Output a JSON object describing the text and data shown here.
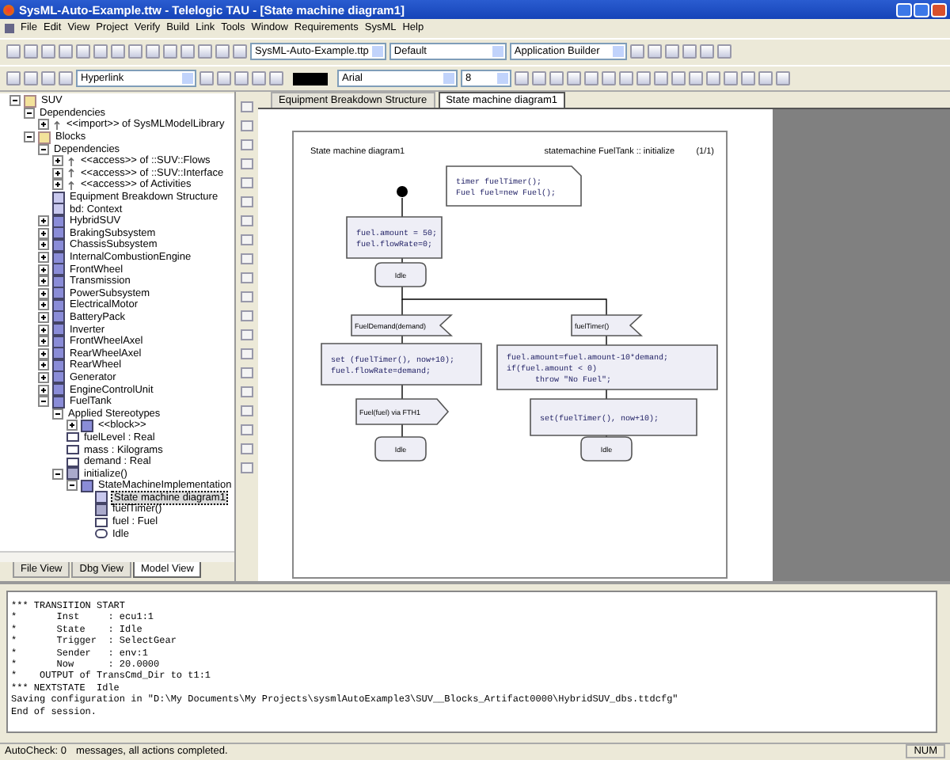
{
  "window": {
    "title": "SysML-Auto-Example.ttw - Telelogic TAU - [State machine diagram1]"
  },
  "menu": [
    "File",
    "Edit",
    "View",
    "Project",
    "Verify",
    "Build",
    "Link",
    "Tools",
    "Window",
    "Requirements",
    "SysML",
    "Help"
  ],
  "toolbar": {
    "project": "SysML-Auto-Example.ttp",
    "configuration": "Default",
    "builder": "Application Builder",
    "link_type": "Hyperlink",
    "font": "Arial",
    "font_size": "8"
  },
  "tree": [
    {
      "label": "SUV",
      "kind": "folder",
      "expanded": true,
      "children": [
        {
          "label": "Dependencies",
          "kind": "label",
          "expanded": true,
          "children": [
            {
              "label": "<<import>> of SysMLModelLibrary",
              "kind": "dependency",
              "expanded": false
            }
          ]
        },
        {
          "label": "Blocks",
          "kind": "folder",
          "expanded": true,
          "children": [
            {
              "label": "Dependencies",
              "kind": "label",
              "expanded": true,
              "children": [
                {
                  "label": "<<access>> of ::SUV::Flows",
                  "kind": "dependency",
                  "expanded": false
                },
                {
                  "label": "<<access>> of ::SUV::Interface",
                  "kind": "dependency",
                  "expanded": false
                },
                {
                  "label": "<<access>> of Activities",
                  "kind": "dependency",
                  "expanded": false
                }
              ]
            },
            {
              "label": "Equipment Breakdown Structure",
              "kind": "diagram"
            },
            {
              "label": "bd: Context",
              "kind": "diagram"
            },
            {
              "label": "HybridSUV",
              "kind": "block",
              "expanded": false
            },
            {
              "label": "BrakingSubsystem",
              "kind": "block",
              "expanded": false
            },
            {
              "label": "ChassisSubsystem",
              "kind": "block",
              "expanded": false
            },
            {
              "label": "InternalCombustionEngine",
              "kind": "block",
              "expanded": false
            },
            {
              "label": "FrontWheel",
              "kind": "block",
              "expanded": false
            },
            {
              "label": "Transmission",
              "kind": "block",
              "expanded": false
            },
            {
              "label": "PowerSubsystem",
              "kind": "block",
              "expanded": false
            },
            {
              "label": "ElectricalMotor",
              "kind": "block",
              "expanded": false
            },
            {
              "label": "BatteryPack",
              "kind": "block",
              "expanded": false
            },
            {
              "label": "Inverter",
              "kind": "block",
              "expanded": false
            },
            {
              "label": "FrontWheelAxel",
              "kind": "block",
              "expanded": false
            },
            {
              "label": "RearWheelAxel",
              "kind": "block",
              "expanded": false
            },
            {
              "label": "RearWheel",
              "kind": "block",
              "expanded": false
            },
            {
              "label": "Generator",
              "kind": "block",
              "expanded": false
            },
            {
              "label": "EngineControlUnit",
              "kind": "block",
              "expanded": false
            },
            {
              "label": "FuelTank",
              "kind": "block",
              "expanded": true,
              "children": [
                {
                  "label": "Applied Stereotypes",
                  "kind": "label",
                  "expanded": true,
                  "children": [
                    {
                      "label": "<<block>>",
                      "kind": "block",
                      "expanded": false
                    }
                  ]
                },
                {
                  "label": "fuelLevel : Real",
                  "kind": "attribute"
                },
                {
                  "label": "mass : Kilograms",
                  "kind": "attribute"
                },
                {
                  "label": "demand : Real",
                  "kind": "attribute"
                },
                {
                  "label": "initialize()",
                  "kind": "operation",
                  "expanded": true,
                  "children": [
                    {
                      "label": "StateMachineImplementation",
                      "kind": "block",
                      "expanded": true,
                      "children": [
                        {
                          "label": "State machine diagram1",
                          "kind": "diagram",
                          "selected": true
                        },
                        {
                          "label": "fuelTimer()",
                          "kind": "operation",
                          "selected": false
                        },
                        {
                          "label": "fuel : Fuel",
                          "kind": "attribute",
                          "selected": false
                        },
                        {
                          "label": "Idle",
                          "kind": "state",
                          "selected": false
                        }
                      ]
                    }
                  ]
                }
              ]
            }
          ]
        }
      ]
    }
  ],
  "view_tabs": [
    {
      "label": "File View",
      "selected": false
    },
    {
      "label": "Dbg View",
      "selected": false
    },
    {
      "label": "Model View",
      "selected": true
    }
  ],
  "editor_tabs": [
    {
      "label": "Equipment Breakdown Structure",
      "selected": false
    },
    {
      "label": "State machine diagram1",
      "selected": true
    }
  ],
  "diagram": {
    "title": "State machine diagram1",
    "context": "statemachine FuelTank :: initialize",
    "page": "(1/1)",
    "nodes": [
      {
        "kind": "note",
        "lines": [
          "timer fuelTimer();",
          "Fuel fuel=new Fuel();"
        ]
      },
      {
        "kind": "start"
      },
      {
        "kind": "task",
        "lines": [
          "fuel.amount = 50;",
          "fuel.flowRate=0;"
        ]
      },
      {
        "kind": "state",
        "lines": [
          "Idle"
        ]
      },
      {
        "kind": "input",
        "lines": [
          "FuelDemand(demand)"
        ]
      },
      {
        "kind": "input",
        "lines": [
          "fuelTimer()"
        ]
      },
      {
        "kind": "task",
        "lines": [
          "set (fuelTimer(), now+10);",
          "fuel.flowRate=demand;"
        ]
      },
      {
        "kind": "task",
        "lines": [
          "fuel.amount=fuel.amount-10*demand;",
          "if(fuel.amount < 0)",
          "      throw \"No Fuel\";"
        ]
      },
      {
        "kind": "output",
        "lines": [
          "Fuel(fuel) via FTH1"
        ]
      },
      {
        "kind": "task",
        "lines": [
          "set(fuelTimer(), now+10);"
        ]
      },
      {
        "kind": "state",
        "lines": [
          "Idle"
        ]
      },
      {
        "kind": "state",
        "lines": [
          "Idle"
        ]
      }
    ]
  },
  "output": [
    "*** TRANSITION START",
    "*       Inst     : ecu1:1",
    "*       State    : Idle",
    "*       Trigger  : SelectGear",
    "*       Sender   : env:1",
    "*       Now      : 20.0000",
    "*    OUTPUT of TransCmd_Dir to t1:1",
    "*** NEXTSTATE  Idle",
    "Saving configuration in \"D:\\My Documents\\My Projects\\sysmlAutoExample3\\SUV__Blocks_Artifact0000\\HybridSUV_dbs.ttdcfg\"",
    "End of session."
  ],
  "status_bar": {
    "autocheck": "AutoCheck: 0",
    "message": "messages, all actions completed.",
    "indicator": "NUM"
  }
}
